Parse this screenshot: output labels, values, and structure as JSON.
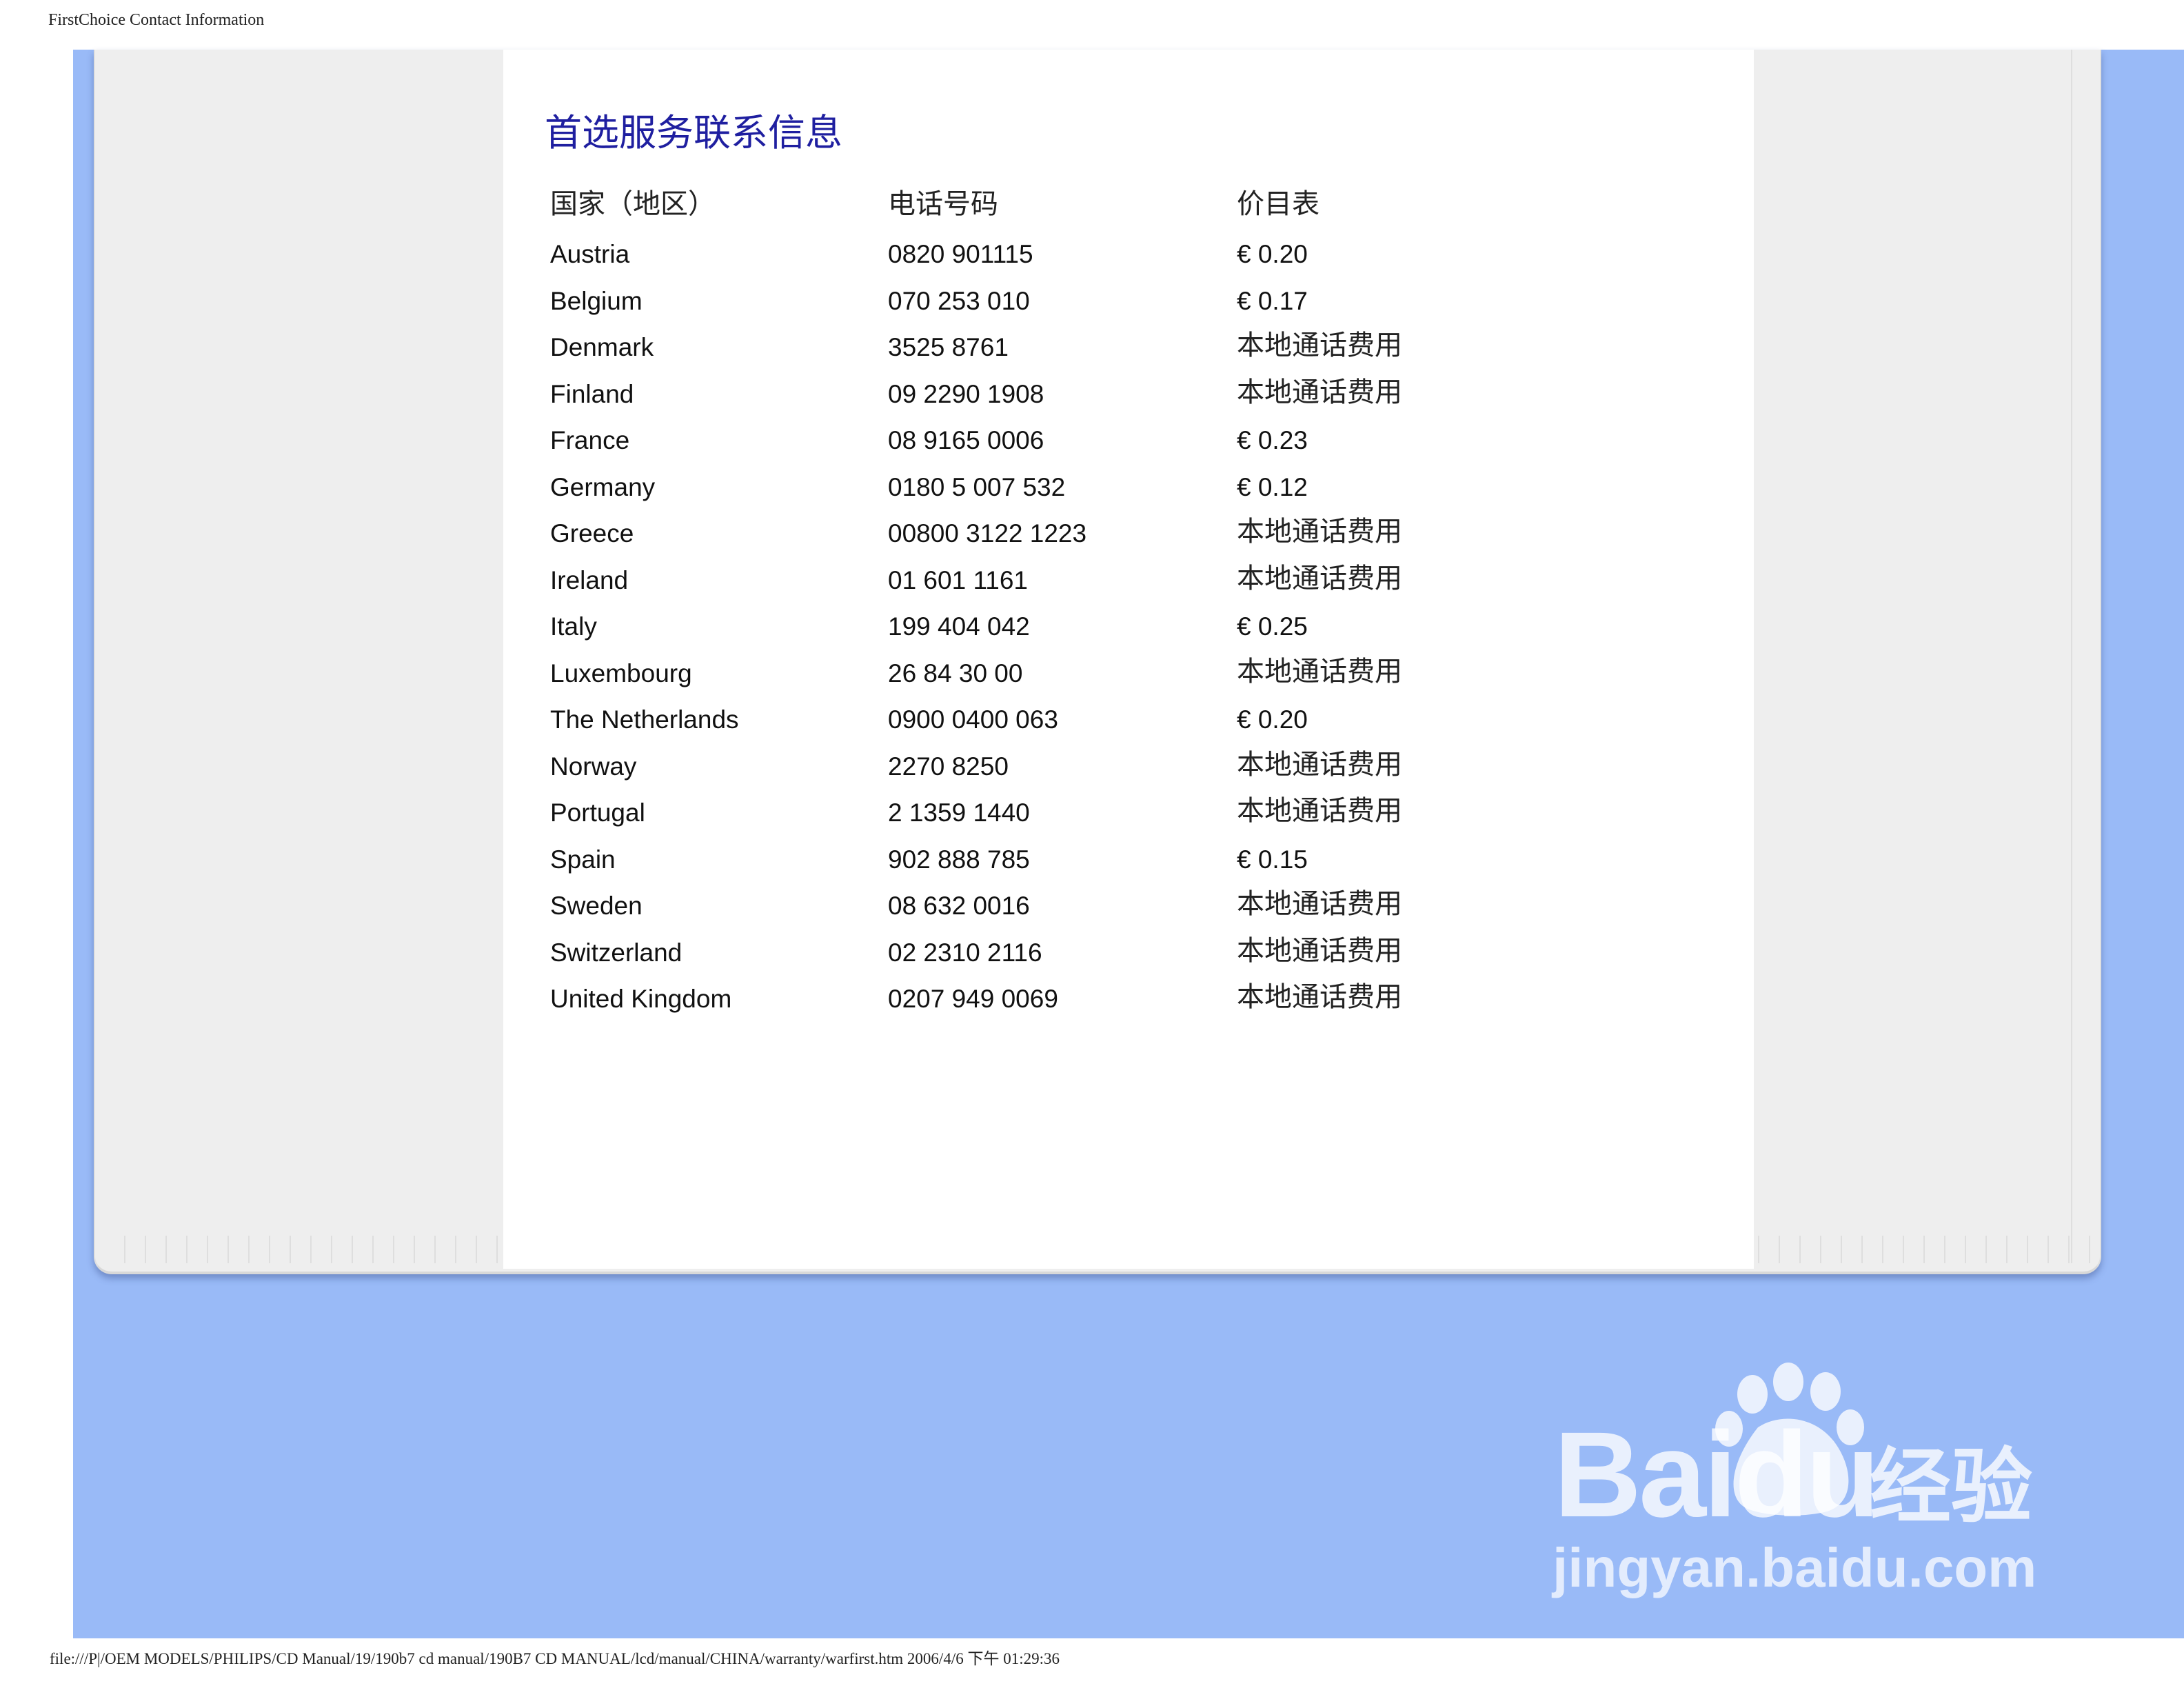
{
  "print_header": "FirstChoice Contact Information",
  "print_footer": "file:///P|/OEM MODELS/PHILIPS/CD Manual/19/190b7 cd manual/190B7 CD MANUAL/lcd/manual/CHINA/warranty/warfirst.htm 2006/4/6 下午 01:29:36",
  "title": "首选服务联系信息",
  "columns": [
    "国家（地区）",
    "电话号码",
    "价目表"
  ],
  "rows": [
    [
      "Austria",
      "0820 901115",
      "€ 0.20"
    ],
    [
      "Belgium",
      "070 253 010",
      "€ 0.17"
    ],
    [
      "Denmark",
      "3525 8761",
      "本地通话费用"
    ],
    [
      "Finland",
      "09 2290 1908",
      "本地通话费用"
    ],
    [
      "France",
      "08 9165 0006",
      "€ 0.23"
    ],
    [
      "Germany",
      "0180 5 007 532",
      "€ 0.12"
    ],
    [
      "Greece",
      "00800 3122 1223",
      "本地通话费用"
    ],
    [
      "Ireland",
      "01 601 1161",
      "本地通话费用"
    ],
    [
      "Italy",
      "199 404 042",
      "€ 0.25"
    ],
    [
      "Luxembourg",
      "26 84 30 00",
      "本地通话费用"
    ],
    [
      "The Netherlands",
      "0900 0400 063",
      "€ 0.20"
    ],
    [
      "Norway",
      "2270 8250",
      "本地通话费用"
    ],
    [
      "Portugal",
      "2 1359 1440",
      "本地通话费用"
    ],
    [
      "Spain",
      "902 888 785",
      "€ 0.15"
    ],
    [
      "Sweden",
      "08 632 0016",
      "本地通话费用"
    ],
    [
      "Switzerland",
      "02 2310 2116",
      "本地通话费用"
    ],
    [
      "United Kingdom",
      "0207 949 0069",
      "本地通话费用"
    ]
  ],
  "watermark": {
    "brand": "Baidu",
    "brand_cn": "经验",
    "url": "jingyan.baidu.com"
  },
  "colors": {
    "background_blue": "#99baf7",
    "panel_grey": "#eeeeee",
    "title_blue": "#1f1fa0"
  }
}
